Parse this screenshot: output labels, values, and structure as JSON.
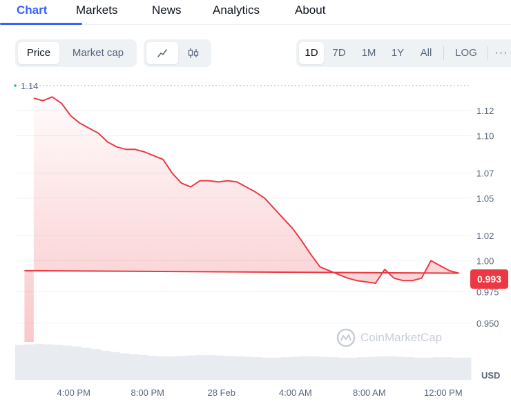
{
  "tabs": [
    {
      "label": "Chart",
      "active": true
    },
    {
      "label": "Markets"
    },
    {
      "label": "News"
    },
    {
      "label": "Analytics"
    },
    {
      "label": "About"
    }
  ],
  "toolbar": {
    "metric_tabs": [
      {
        "label": "Price",
        "active": true
      },
      {
        "label": "Market cap"
      }
    ],
    "chart_type_icons": [
      "line-chart-icon",
      "candlestick-icon"
    ],
    "ranges": [
      {
        "label": "1D",
        "active": true
      },
      {
        "label": "7D"
      },
      {
        "label": "1M"
      },
      {
        "label": "1Y"
      },
      {
        "label": "All"
      }
    ],
    "log_label": "LOG",
    "more_icon": "more-horizontal-icon"
  },
  "watermark": "CoinMarketCap",
  "current_price_label": "0.993",
  "high_label": "1.14",
  "colors": {
    "accent": "#3861fb",
    "line": "#ea3943",
    "badge": "#ea3943",
    "volume": "#e8ebef"
  },
  "chart_data": {
    "type": "line",
    "xlabel": "",
    "ylabel": "USD",
    "x_ticks": [
      "4:00 PM",
      "8:00 PM",
      "28 Feb",
      "4:00 AM",
      "8:00 AM",
      "12:00 PM"
    ],
    "y_ticks": [
      "0.950",
      "0.975",
      "1.00",
      "1.02",
      "1.05",
      "1.07",
      "1.10",
      "1.12"
    ],
    "ylim": [
      0.935,
      1.145
    ],
    "high": 1.14,
    "current": 0.993,
    "grid": true,
    "series": [
      {
        "x": [
          "13:50",
          "14:20",
          "14:50",
          "15:20",
          "15:50",
          "16:20",
          "16:50",
          "17:20",
          "17:50",
          "18:20",
          "18:50",
          "19:20",
          "19:50",
          "20:20",
          "20:50",
          "21:20",
          "21:50",
          "22:20",
          "22:50",
          "23:20",
          "23:50",
          "00:20",
          "00:50",
          "01:20",
          "01:50",
          "02:20",
          "02:50",
          "03:20",
          "03:50",
          "04:20",
          "04:50",
          "05:20",
          "05:50",
          "06:20",
          "06:50",
          "07:20",
          "07:50",
          "08:20",
          "08:50",
          "09:20",
          "09:50",
          "10:20",
          "10:50",
          "11:20",
          "11:50",
          "12:20",
          "12:50",
          "13:20"
        ],
        "values": [
          1.13,
          1.128,
          1.131,
          1.126,
          1.116,
          1.11,
          1.106,
          1.102,
          1.095,
          1.091,
          1.089,
          1.089,
          1.087,
          1.084,
          1.081,
          1.07,
          1.062,
          1.059,
          1.064,
          1.064,
          1.063,
          1.064,
          1.063,
          1.059,
          1.055,
          1.05,
          1.042,
          1.034,
          1.026,
          1.016,
          1.005,
          0.995,
          0.992,
          0.989,
          0.986,
          0.984,
          0.983,
          0.982,
          0.993,
          0.986,
          0.984,
          0.984,
          0.986,
          1.0,
          0.996,
          0.992,
          0.99,
          0.992
        ]
      }
    ],
    "volume": [
      0.82,
      0.83,
      0.84,
      0.83,
      0.82,
      0.8,
      0.78,
      0.75,
      0.72,
      0.68,
      0.65,
      0.62,
      0.6,
      0.58,
      0.56,
      0.55,
      0.55,
      0.56,
      0.57,
      0.58,
      0.58,
      0.57,
      0.56,
      0.55,
      0.54,
      0.53,
      0.52,
      0.52,
      0.53,
      0.54,
      0.55,
      0.55,
      0.54,
      0.53,
      0.52,
      0.52,
      0.53,
      0.54,
      0.55,
      0.55,
      0.54,
      0.53,
      0.52,
      0.52,
      0.53,
      0.53,
      0.52,
      0.52
    ]
  }
}
